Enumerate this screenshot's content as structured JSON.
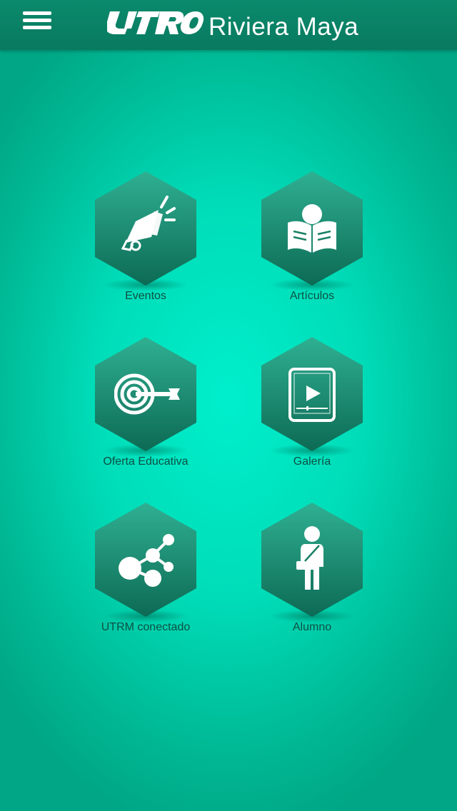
{
  "header": {
    "menu_icon": "hamburger-menu-icon",
    "logo_mark": "UTRM",
    "brand_text": "Riviera Maya"
  },
  "colors": {
    "header_bg": "#087a60",
    "background": "#00dcb8",
    "hex_top": "#27a98a",
    "hex_bottom": "#0f6e57",
    "label_text": "#0e4f42"
  },
  "menu": {
    "items": [
      {
        "label": "Eventos",
        "icon": "megaphone-icon"
      },
      {
        "label": "Artículos",
        "icon": "reading-person-icon"
      },
      {
        "label": "Oferta Educativa",
        "icon": "target-dart-icon"
      },
      {
        "label": "Galería",
        "icon": "tablet-play-icon"
      },
      {
        "label": "UTRM conectado",
        "icon": "network-nodes-icon"
      },
      {
        "label": "Alumno",
        "icon": "student-icon"
      }
    ]
  }
}
